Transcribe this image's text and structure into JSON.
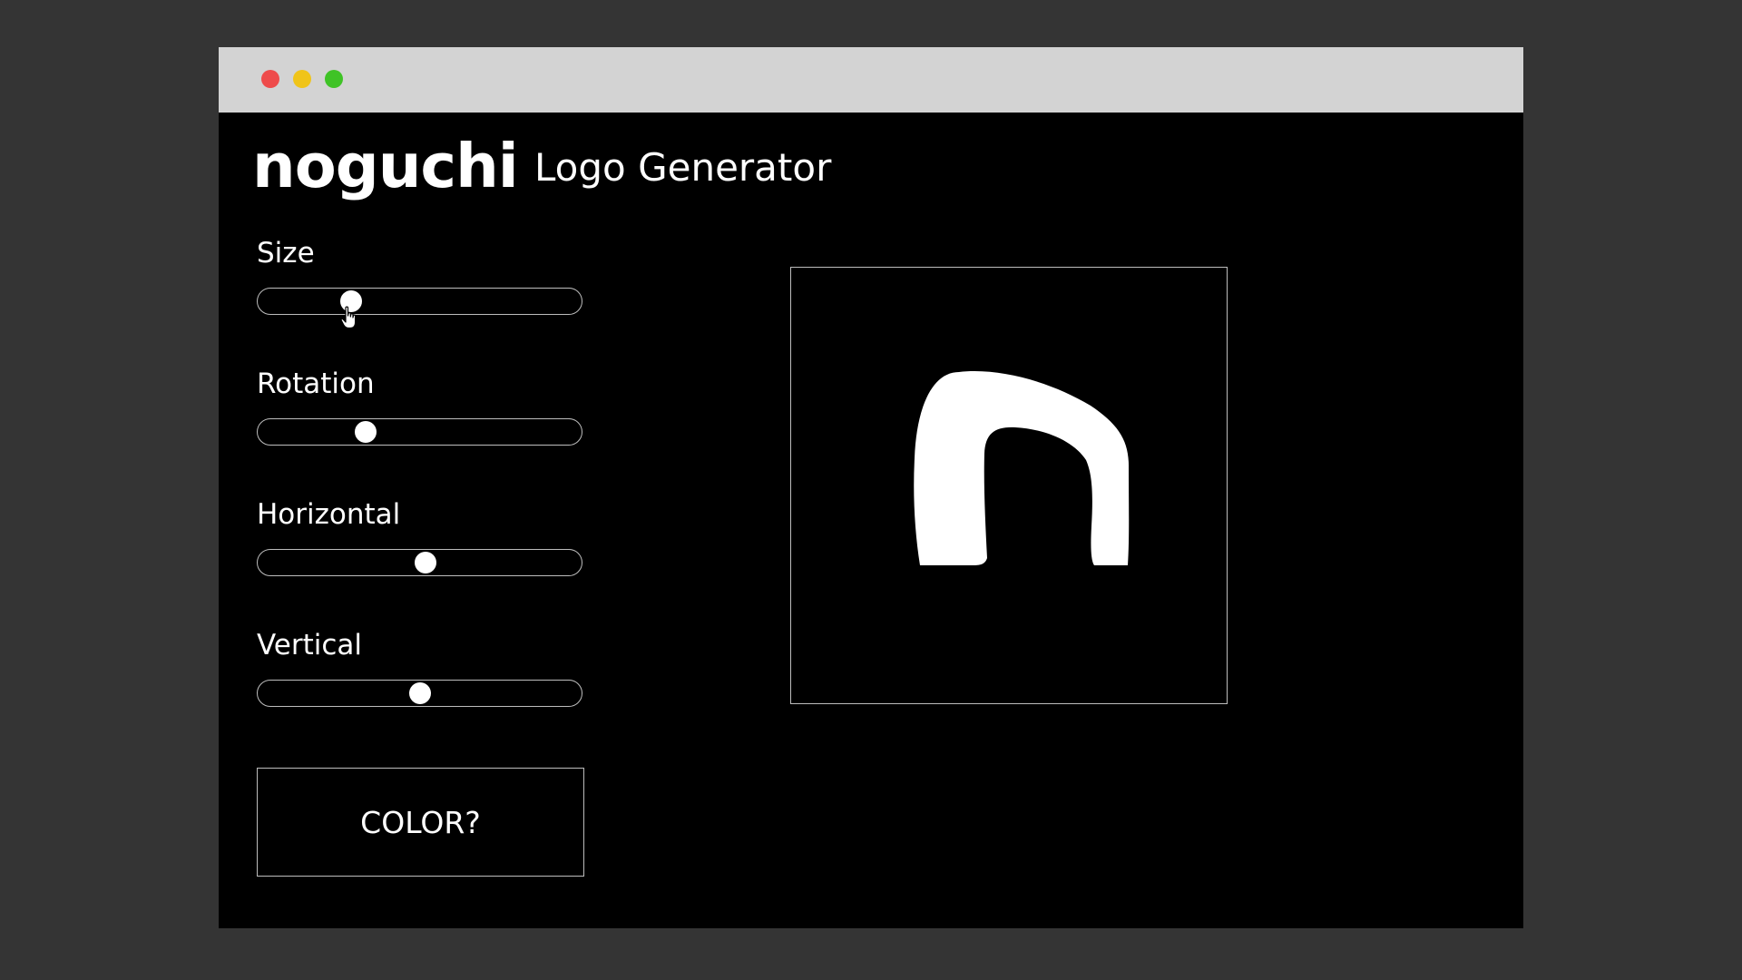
{
  "window": {
    "traffic_lights": [
      {
        "name": "close",
        "color": "#ee4b4b"
      },
      {
        "name": "minimize",
        "color": "#f0c419"
      },
      {
        "name": "maximize",
        "color": "#3fc326"
      }
    ]
  },
  "header": {
    "brand": "noguchi",
    "subtitle": "Logo Generator"
  },
  "controls": {
    "size": {
      "label": "Size",
      "value_fraction": 0.27
    },
    "rotation": {
      "label": "Rotation",
      "value_fraction": 0.32
    },
    "horizontal": {
      "label": "Horizontal",
      "value_fraction": 0.52
    },
    "vertical": {
      "label": "Vertical",
      "value_fraction": 0.5
    }
  },
  "color_button": {
    "label": "COLOR?"
  },
  "preview": {
    "shape": "arch",
    "fill_color": "#ffffff",
    "background": "#000000"
  },
  "icons": {
    "cursor": "pointer-hand-icon"
  }
}
